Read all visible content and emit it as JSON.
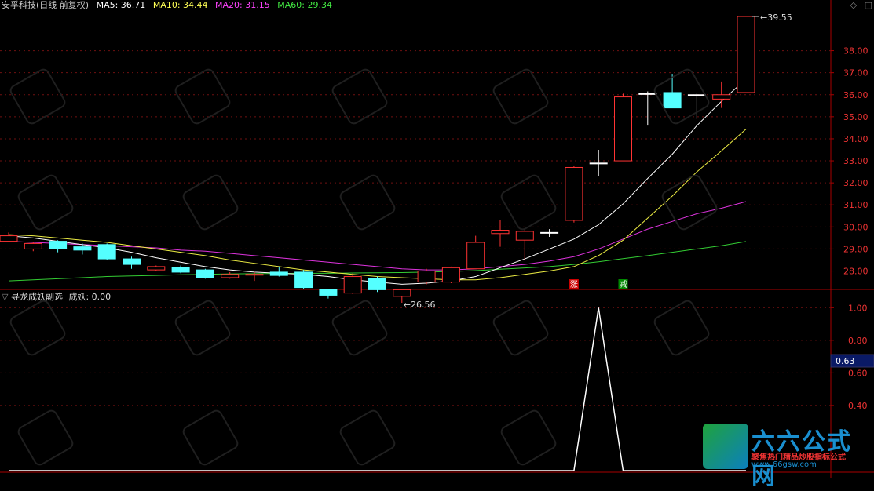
{
  "main_panel": {
    "title": "安孚科技(日线 前复权)",
    "ma_legend": [
      {
        "label": "MA5: 36.71",
        "color": "#ffffff"
      },
      {
        "label": "MA10: 34.44",
        "color": "#ffff55"
      },
      {
        "label": "MA20: 31.15",
        "color": "#ff44ff"
      },
      {
        "label": "MA60: 29.34",
        "color": "#44ee44"
      }
    ],
    "high_label": "39.55",
    "low_label": "26.56",
    "tag_up": "涨",
    "tag_down": "减"
  },
  "sub_panel": {
    "title": "寻龙成妖副选",
    "value_label": "成妖: 0.00",
    "current_value": "0.63"
  },
  "watermark": {
    "brand": "六六公式网",
    "slogan": "聚焦热门精品炒股指标公式",
    "url": "www.66gsw.com"
  },
  "chart_data": {
    "type": "candlestick",
    "y_ticks": [
      28,
      29,
      30,
      31,
      32,
      33,
      34,
      35,
      36,
      37,
      38
    ],
    "y_tick_labels": [
      "28.00",
      "29.00",
      "30.00",
      "31.00",
      "32.00",
      "33.00",
      "34.00",
      "35.00",
      "36.00",
      "37.00",
      "38.00"
    ],
    "ylim": [
      27.2,
      39.8
    ],
    "candles": [
      {
        "o": 29.35,
        "c": 29.6,
        "h": 29.75,
        "l": 29.3
      },
      {
        "o": 29.0,
        "c": 29.25,
        "h": 29.3,
        "l": 28.9
      },
      {
        "o": 29.35,
        "c": 29.0,
        "h": 29.4,
        "l": 28.85
      },
      {
        "o": 29.1,
        "c": 28.95,
        "h": 29.25,
        "l": 28.75
      },
      {
        "o": 29.2,
        "c": 28.55,
        "h": 29.25,
        "l": 28.5
      },
      {
        "o": 28.55,
        "c": 28.3,
        "h": 28.65,
        "l": 28.1
      },
      {
        "o": 28.05,
        "c": 28.2,
        "h": 28.25,
        "l": 28.0
      },
      {
        "o": 28.15,
        "c": 27.95,
        "h": 28.25,
        "l": 27.9
      },
      {
        "o": 28.05,
        "c": 27.7,
        "h": 28.1,
        "l": 27.65
      },
      {
        "o": 27.7,
        "c": 27.85,
        "h": 27.95,
        "l": 27.65
      },
      {
        "o": 27.85,
        "c": 27.85,
        "h": 27.95,
        "l": 27.55
      },
      {
        "o": 27.95,
        "c": 27.8,
        "h": 28.2,
        "l": 27.75
      },
      {
        "o": 27.95,
        "c": 27.25,
        "h": 28.05,
        "l": 27.2
      },
      {
        "o": 27.15,
        "c": 26.9,
        "h": 27.15,
        "l": 26.75
      },
      {
        "o": 27.0,
        "c": 27.75,
        "h": 27.9,
        "l": 26.95
      },
      {
        "o": 27.65,
        "c": 27.15,
        "h": 27.75,
        "l": 27.05
      },
      {
        "o": 26.85,
        "c": 27.15,
        "h": 27.2,
        "l": 26.56
      },
      {
        "o": 27.5,
        "c": 28.0,
        "h": 28.1,
        "l": 27.4
      },
      {
        "o": 27.5,
        "c": 28.15,
        "h": 28.2,
        "l": 27.45
      },
      {
        "o": 28.1,
        "c": 29.3,
        "h": 29.6,
        "l": 28.1
      },
      {
        "o": 29.7,
        "c": 29.85,
        "h": 30.3,
        "l": 29.1
      },
      {
        "o": 29.4,
        "c": 29.8,
        "h": 29.9,
        "l": 28.5
      },
      {
        "o": 29.75,
        "c": 29.75,
        "h": 29.9,
        "l": 29.55
      },
      {
        "o": 30.3,
        "c": 32.7,
        "h": 32.75,
        "l": 30.2
      },
      {
        "o": 32.9,
        "c": 32.9,
        "h": 33.5,
        "l": 32.3
      },
      {
        "o": 33.0,
        "c": 35.9,
        "h": 36.05,
        "l": 33.0
      },
      {
        "o": 36.05,
        "c": 36.05,
        "h": 36.15,
        "l": 34.6
      },
      {
        "o": 36.1,
        "c": 35.4,
        "h": 36.95,
        "l": 35.4
      },
      {
        "o": 36.0,
        "c": 36.0,
        "h": 36.05,
        "l": 34.9
      },
      {
        "o": 35.8,
        "c": 36.0,
        "h": 36.6,
        "l": 35.4
      },
      {
        "o": 36.1,
        "c": 39.55,
        "h": 39.55,
        "l": 36.1
      }
    ],
    "ma5": [
      29.6,
      29.5,
      29.35,
      29.2,
      29.05,
      28.85,
      28.6,
      28.4,
      28.2,
      28.05,
      27.95,
      27.9,
      27.85,
      27.75,
      27.6,
      27.5,
      27.4,
      27.45,
      27.55,
      27.75,
      28.15,
      28.55,
      29.0,
      29.45,
      30.1,
      31.05,
      32.2,
      33.3,
      34.6,
      35.7,
      36.71
    ],
    "ma10": [
      29.65,
      29.6,
      29.5,
      29.4,
      29.3,
      29.15,
      29.0,
      28.85,
      28.7,
      28.5,
      28.35,
      28.2,
      28.05,
      27.95,
      27.85,
      27.75,
      27.7,
      27.65,
      27.6,
      27.6,
      27.7,
      27.85,
      28.0,
      28.2,
      28.7,
      29.4,
      30.4,
      31.4,
      32.5,
      33.45,
      34.44
    ],
    "ma20": [
      29.35,
      29.3,
      29.25,
      29.2,
      29.15,
      29.1,
      29.05,
      28.95,
      28.9,
      28.8,
      28.7,
      28.6,
      28.5,
      28.4,
      28.3,
      28.2,
      28.1,
      28.05,
      28.05,
      28.1,
      28.2,
      28.3,
      28.45,
      28.65,
      29.0,
      29.45,
      29.9,
      30.25,
      30.6,
      30.85,
      31.15
    ],
    "ma60": [
      27.55,
      27.6,
      27.65,
      27.7,
      27.75,
      27.78,
      27.8,
      27.83,
      27.85,
      27.87,
      27.88,
      27.89,
      27.9,
      27.9,
      27.91,
      27.92,
      27.93,
      27.95,
      27.98,
      28.02,
      28.08,
      28.14,
      28.2,
      28.3,
      28.42,
      28.56,
      28.7,
      28.85,
      29.0,
      29.15,
      29.34
    ],
    "sub": {
      "series": [
        0,
        0,
        0,
        0,
        0,
        0,
        0,
        0,
        0,
        0,
        0,
        0,
        0,
        0,
        0,
        0,
        0,
        0,
        0,
        0,
        0,
        0,
        0,
        0,
        1,
        0,
        0,
        0,
        0,
        0,
        0
      ],
      "y_ticks": [
        0.4,
        0.6,
        0.8,
        1.0
      ],
      "y_tick_labels": [
        "0.40",
        "0.60",
        "0.80",
        "1.00"
      ],
      "ylim": [
        0,
        1.04
      ],
      "line_color": "#ffffff"
    }
  }
}
